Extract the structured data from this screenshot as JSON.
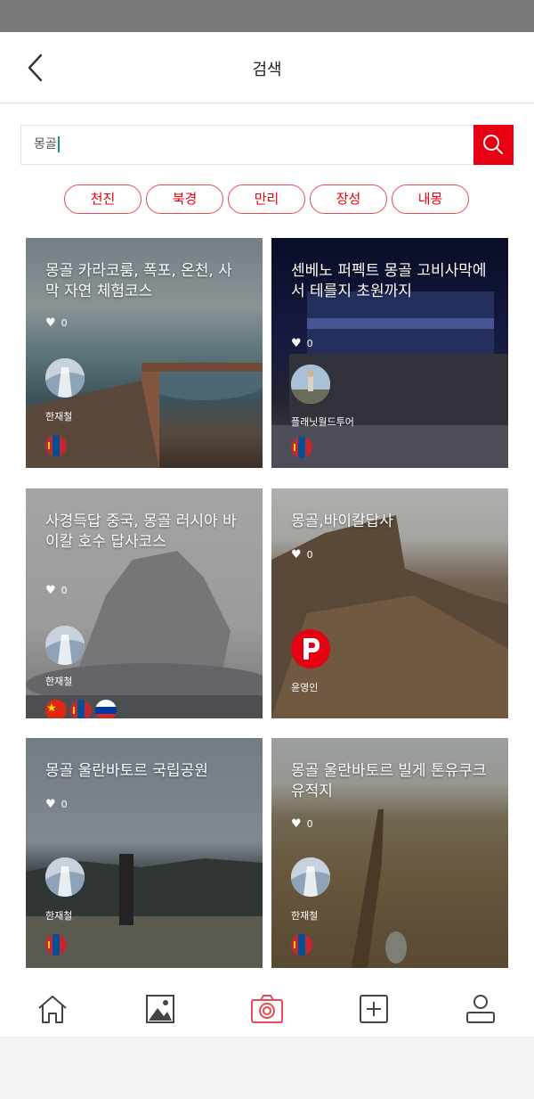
{
  "header": {
    "title": "검색"
  },
  "search": {
    "value": "몽골"
  },
  "chips": [
    "천진",
    "북경",
    "만리",
    "장성",
    "내몽"
  ],
  "cards": [
    {
      "title": "몽골 카라코룸, 폭포, 온천, 사막 자연 체험코스",
      "likes": "0",
      "author": "한재철"
    },
    {
      "title": "센베노 퍼펙트 몽골 고비사막에서 테를지 초원까지",
      "likes": "0",
      "author": "플래닛월드투어"
    },
    {
      "title": "사경득답 중국, 몽골 러시아 바이칼 호수 답사코스",
      "likes": "0",
      "author": "한재철"
    },
    {
      "title": "몽골,바이칼답사",
      "likes": "0",
      "author": "윤영인"
    },
    {
      "title": "몽골 울란바토르 국립공원",
      "likes": "0",
      "author": "한재철"
    },
    {
      "title": "몽골 울란바토르 빌게 톤유쿠크 유적지",
      "likes": "0",
      "author": "한재철"
    }
  ],
  "colors": {
    "accent": "#e60012",
    "chip_border": "#e84a55"
  },
  "icons": [
    "back-arrow-icon",
    "search-icon",
    "heart-icon",
    "home-icon",
    "gallery-icon",
    "camera-icon",
    "add-icon",
    "user-icon"
  ]
}
